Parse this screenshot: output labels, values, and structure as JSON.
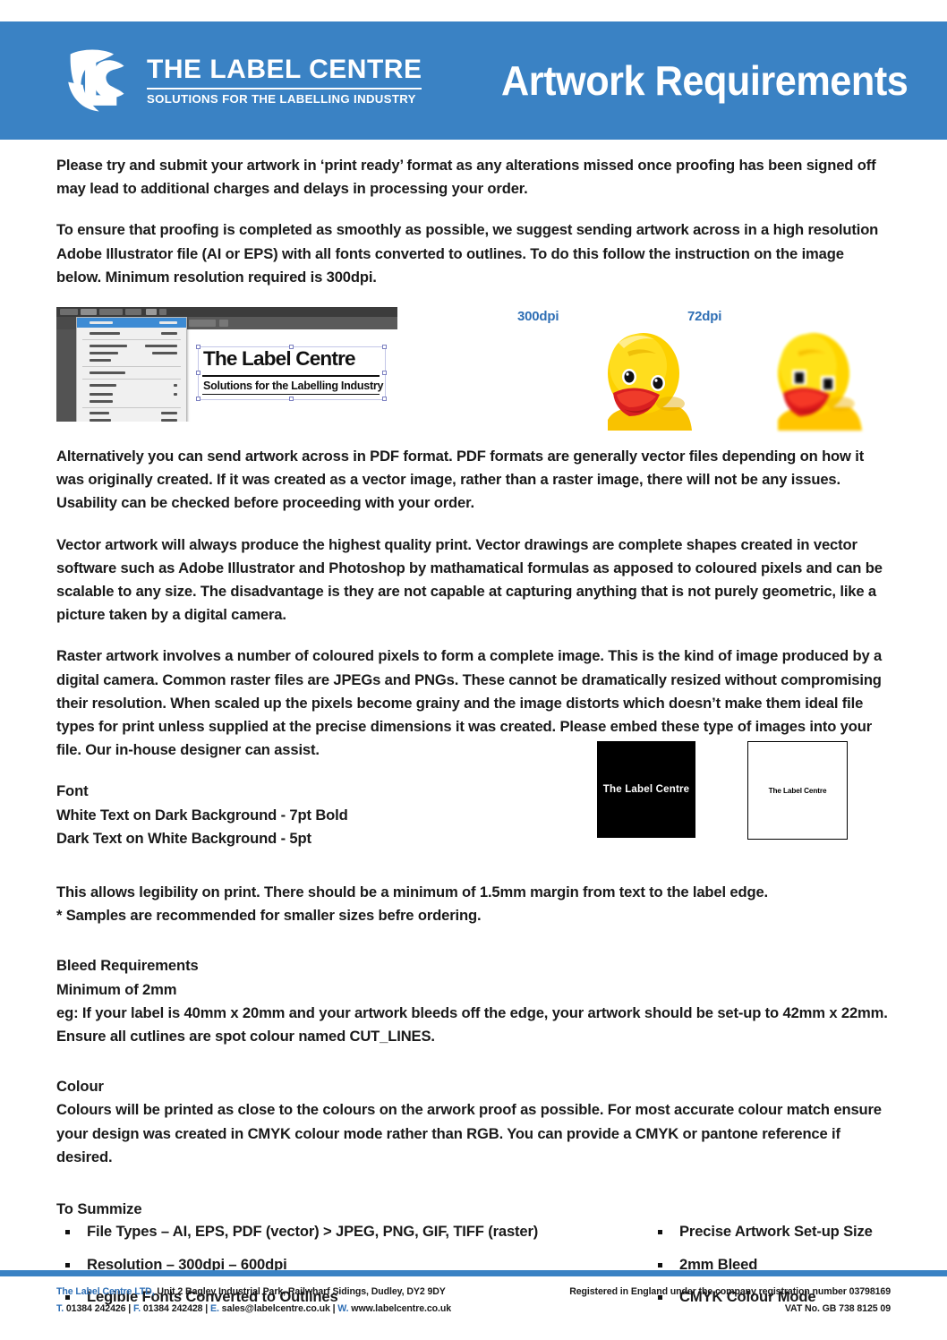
{
  "header": {
    "logo_title": "THE LABEL CENTRE",
    "logo_subtitle": "SOLUTIONS FOR THE LABELLING INDUSTRY",
    "logo_icon": "lc-monogram-logo",
    "title": "Artwork Requirements",
    "bar_color": "#3a82c4"
  },
  "body": {
    "intro_paragraph": "Please try and submit your artwork in ‘print ready’ format as any alterations missed once proofing has been signed off may lead to additional charges and delays in processing your order.",
    "proofing_paragraph": "To ensure that proofing is completed as smoothly as possible, we suggest sending artwork across in a high resolution Adobe Illustrator file (AI or EPS) with all fonts converted to outlines. To do this follow the instruction on the image below. Minimum resolution required is 300dpi.",
    "pdf_paragraph": "Alternatively you can send artwork across in PDF format. PDF formats are generally vector files depending on how it was originally created. If it was created as a vector image, rather than a raster image, there will not be any issues. Usability can be checked before proceeding with your order.",
    "vector_label": "Vector",
    "vector_paragraph": " artwork will always produce the highest quality print. Vector drawings are complete shapes created in vector software such as Adobe Illustrator and Photoshop by mathamatical formulas as apposed to coloured pixels and can be scalable to any size. The disadvantage is they are not capable at capturing anything that is not purely geometric, like a picture taken by a digital camera.",
    "raster_label": "Raster",
    "raster_paragraph": " artwork involves a number of coloured pixels to form a complete image. This is the kind of image produced by a digital camera. Common raster files are JPEGs and PNGs. These cannot be dramatically resized without compromising their resolution. When scaled up the pixels become grainy and the image distorts which doesn’t make them ideal file types for print unless supplied at the precise dimensions it was created. Please embed these type of images into your file. Our in-house designer can assist."
  },
  "illustrator_screenshot": {
    "artboard_title": "The Label Centre",
    "artboard_subtitle": "Solutions for the Labelling Industry"
  },
  "dpi_comparison": {
    "high_label": "300dpi",
    "low_label": "72dpi",
    "image_alt": "rubber-duck-photo"
  },
  "font_section": {
    "heading": "Font",
    "line1": "White Text on Dark Background - 7pt Bold",
    "line2": "Dark Text on White Background - 5pt",
    "sample_dark_text": "The Label Centre",
    "sample_light_text": "The Label Centre",
    "note1": "This allows legibility on print. There should be a minimum of 1.5mm margin from text to the label edge.",
    "note2": "* Samples are recommended for smaller sizes befre ordering."
  },
  "bleed_section": {
    "heading": "Bleed Requirements",
    "line1": "Minimum of 2mm",
    "line2": "eg: If your label is 40mm x 20mm and your artwork bleeds off the edge, your artwork should be set-up to 42mm x 22mm. Ensure all cutlines are spot colour named CUT_LINES."
  },
  "colour_section": {
    "heading": "Colour",
    "paragraph": "Colours will be printed as close to the colours on the arwork proof  as possible. For most accurate colour match ensure your design was created in CMYK colour mode rather than RGB. You can provide a CMYK or pantone reference if desired."
  },
  "summary_section": {
    "heading": "To Summize",
    "left_items": [
      "File Types – AI, EPS, PDF (vector) > JPEG, PNG, GIF, TIFF (raster)",
      "Resolution – 300dpi – 600dpi",
      "Legible Fonts Converted to Outlines"
    ],
    "right_items": [
      "Precise Artwork Set-up Size",
      "2mm Bleed",
      "CMYK Colour Mode"
    ]
  },
  "footer": {
    "company": "The Label Centre LTD,",
    "address": " Unit 2 Bagley Industrial Park, Railwharf Sidings, Dudley, DY2 9DY",
    "tel_label": "T.",
    "tel": " 01384 242426 | ",
    "fax_label": "F.",
    "fax": " 01384 242428 | ",
    "email_label": "E.",
    "email": " sales@labelcentre.co.uk | ",
    "web_label": "W.",
    "web": " www.labelcentre.co.uk",
    "registration": "Registered in England under the company registration number 03798169",
    "vat": "VAT No. GB 738 8125 09",
    "accent_color": "#2f6fb5"
  }
}
